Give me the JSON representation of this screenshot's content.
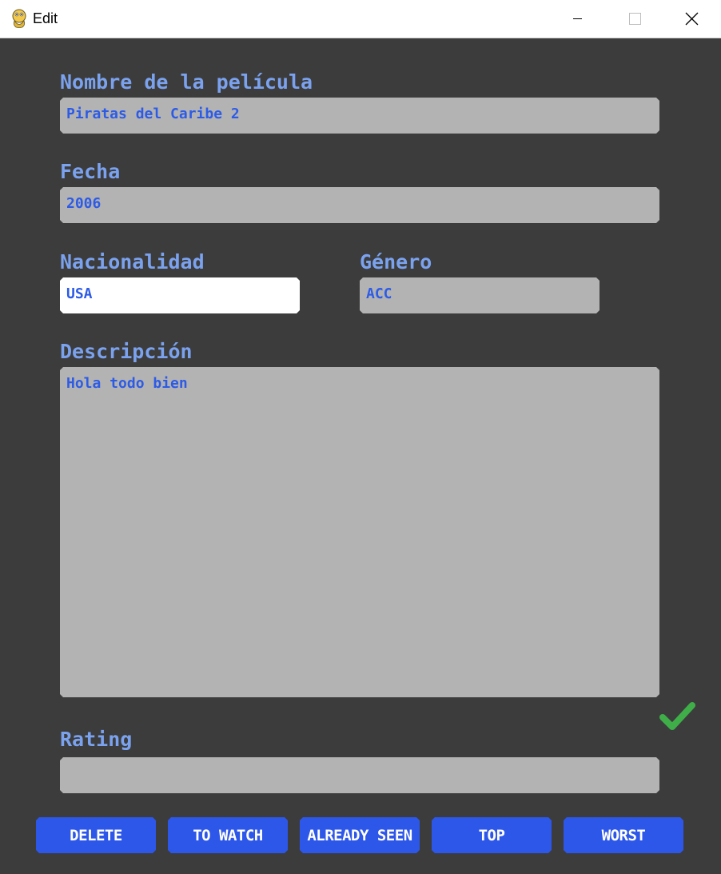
{
  "window": {
    "title": "Edit",
    "icon": "python-snake-icon"
  },
  "form": {
    "name_label": "Nombre de la película",
    "name_value": "Piratas del Caribe 2",
    "date_label": "Fecha",
    "date_value": "2006",
    "nationality_label": "Nacionalidad",
    "nationality_value": "USA",
    "genre_label": "Género",
    "genre_value": "ACC",
    "description_label": "Descripción",
    "description_value": "Hola todo bien",
    "rating_label": "Rating",
    "rating_value": ""
  },
  "buttons": {
    "delete": "DELETE",
    "to_watch": "TO WATCH",
    "already_seen": "ALREADY SEEN",
    "top": "TOP",
    "worst": "WORST"
  },
  "colors": {
    "background": "#3c3c3c",
    "label": "#7ba2ee",
    "field_bg": "#b3b3b3",
    "field_text": "#2d5be6",
    "button_bg": "#2d57e8",
    "check": "#3fae49"
  }
}
